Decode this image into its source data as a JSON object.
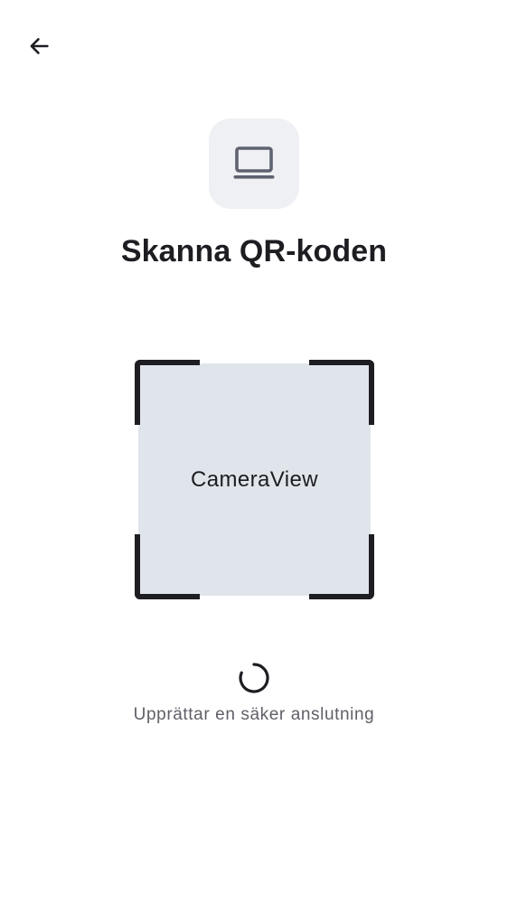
{
  "header": {
    "back_icon": "arrow-left-icon"
  },
  "device": {
    "icon": "laptop-icon",
    "tile_color": "#eff0f4"
  },
  "title": "Skanna QR-koden",
  "scanner": {
    "camera_label": "CameraView",
    "frame_color": "#1d1d22",
    "view_color": "#e0e5eb"
  },
  "status": {
    "icon": "loading-spinner-icon",
    "text": "Upprättar en säker anslutning"
  }
}
